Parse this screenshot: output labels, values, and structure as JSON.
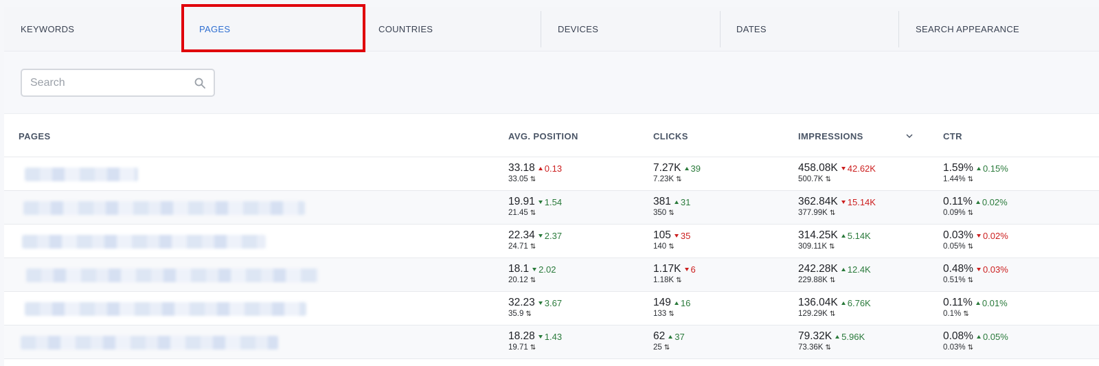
{
  "tabs": [
    {
      "label": "KEYWORDS",
      "active": false
    },
    {
      "label": "PAGES",
      "active": true
    },
    {
      "label": "COUNTRIES",
      "active": false
    },
    {
      "label": "DEVICES",
      "active": false
    },
    {
      "label": "DATES",
      "active": false
    },
    {
      "label": "SEARCH APPEARANCE",
      "active": false
    }
  ],
  "search": {
    "placeholder": "Search",
    "icon": "search-icon"
  },
  "table": {
    "headers": {
      "pages": "PAGES",
      "avg_position": "AVG. POSITION",
      "clicks": "CLICKS",
      "impressions": "IMPRESSIONS",
      "ctr": "CTR"
    },
    "sorted_by": "IMPRESSIONS",
    "rows": [
      {
        "position": {
          "value": "33.18",
          "delta": "0.13",
          "dir": "up",
          "tone": "bad",
          "prev": "33.05"
        },
        "clicks": {
          "value": "7.27K",
          "delta": "39",
          "dir": "up",
          "tone": "good",
          "prev": "7.23K"
        },
        "impressions": {
          "value": "458.08K",
          "delta": "42.62K",
          "dir": "down",
          "tone": "bad",
          "prev": "500.7K"
        },
        "ctr": {
          "value": "1.59%",
          "delta": "0.15%",
          "dir": "up",
          "tone": "good",
          "prev": "1.44%"
        }
      },
      {
        "position": {
          "value": "19.91",
          "delta": "1.54",
          "dir": "down",
          "tone": "good",
          "prev": "21.45"
        },
        "clicks": {
          "value": "381",
          "delta": "31",
          "dir": "up",
          "tone": "good",
          "prev": "350"
        },
        "impressions": {
          "value": "362.84K",
          "delta": "15.14K",
          "dir": "down",
          "tone": "bad",
          "prev": "377.99K"
        },
        "ctr": {
          "value": "0.11%",
          "delta": "0.02%",
          "dir": "up",
          "tone": "good",
          "prev": "0.09%"
        }
      },
      {
        "position": {
          "value": "22.34",
          "delta": "2.37",
          "dir": "down",
          "tone": "good",
          "prev": "24.71"
        },
        "clicks": {
          "value": "105",
          "delta": "35",
          "dir": "down",
          "tone": "bad",
          "prev": "140"
        },
        "impressions": {
          "value": "314.25K",
          "delta": "5.14K",
          "dir": "up",
          "tone": "good",
          "prev": "309.11K"
        },
        "ctr": {
          "value": "0.03%",
          "delta": "0.02%",
          "dir": "down",
          "tone": "bad",
          "prev": "0.05%"
        }
      },
      {
        "position": {
          "value": "18.1",
          "delta": "2.02",
          "dir": "down",
          "tone": "good",
          "prev": "20.12"
        },
        "clicks": {
          "value": "1.17K",
          "delta": "6",
          "dir": "down",
          "tone": "bad",
          "prev": "1.18K"
        },
        "impressions": {
          "value": "242.28K",
          "delta": "12.4K",
          "dir": "up",
          "tone": "good",
          "prev": "229.88K"
        },
        "ctr": {
          "value": "0.48%",
          "delta": "0.03%",
          "dir": "down",
          "tone": "bad",
          "prev": "0.51%"
        }
      },
      {
        "position": {
          "value": "32.23",
          "delta": "3.67",
          "dir": "down",
          "tone": "good",
          "prev": "35.9"
        },
        "clicks": {
          "value": "149",
          "delta": "16",
          "dir": "up",
          "tone": "good",
          "prev": "133"
        },
        "impressions": {
          "value": "136.04K",
          "delta": "6.76K",
          "dir": "up",
          "tone": "good",
          "prev": "129.29K"
        },
        "ctr": {
          "value": "0.11%",
          "delta": "0.01%",
          "dir": "up",
          "tone": "good",
          "prev": "0.1%"
        }
      },
      {
        "position": {
          "value": "18.28",
          "delta": "1.43",
          "dir": "down",
          "tone": "good",
          "prev": "19.71"
        },
        "clicks": {
          "value": "62",
          "delta": "37",
          "dir": "up",
          "tone": "good",
          "prev": "25"
        },
        "impressions": {
          "value": "79.32K",
          "delta": "5.96K",
          "dir": "up",
          "tone": "good",
          "prev": "73.36K"
        },
        "ctr": {
          "value": "0.08%",
          "delta": "0.05%",
          "dir": "up",
          "tone": "good",
          "prev": "0.03%"
        }
      }
    ]
  },
  "colors": {
    "active_tab": "#2f6fd1",
    "good": "#2a7a3b",
    "bad": "#cc1e1e",
    "highlight": "#e0000b"
  }
}
